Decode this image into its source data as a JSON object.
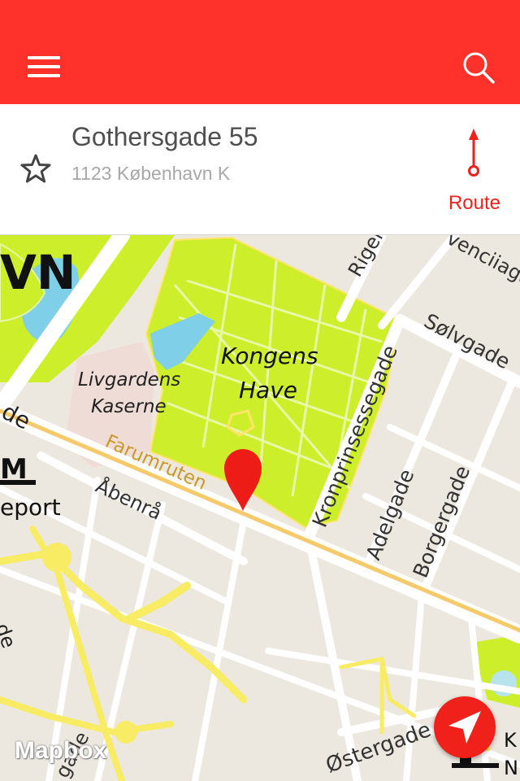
{
  "header": {
    "menu_icon": "hamburger-menu-icon",
    "search_icon": "search-icon",
    "background_color": "#ff322b"
  },
  "location": {
    "street": "Gothersgade 55",
    "city": "1123 København K",
    "favorite_icon": "star-outline-icon",
    "route_label": "Route",
    "route_icon": "route-arrow-icon",
    "accent_color": "#f0201a"
  },
  "map": {
    "park_name": "Kongens Have",
    "park_name_line1": "Kongens",
    "park_name_line2": "Have",
    "barracks_line1": "Livgardens",
    "barracks_line2": "Kaserne",
    "route_name": "Farumruten",
    "streets": {
      "aabenraa": "Åbenrå",
      "kronprinsessegade": "Kronprinsessegade",
      "adelgade": "Adelgade",
      "borgergade": "Borgergade",
      "soelvgade": "Sølvgade",
      "oestergade": "Østergade",
      "rigens": "Rigen",
      "vendersgade": "venciiaga",
      "partial_left_top": "VN",
      "partial_left_de": "de",
      "partial_left_mid": "eport",
      "partial_left_bottom": "de",
      "partial_gade_bottom": "gade",
      "partial_right_k": "K",
      "partial_right_n": "N"
    },
    "metro_badge": "M",
    "pin_icon": "location-pin-icon",
    "locate_icon": "navigation-arrow-icon",
    "attribution": "Mapbox",
    "park_color": "#cdee2a",
    "water_color": "#7fcfe8"
  }
}
